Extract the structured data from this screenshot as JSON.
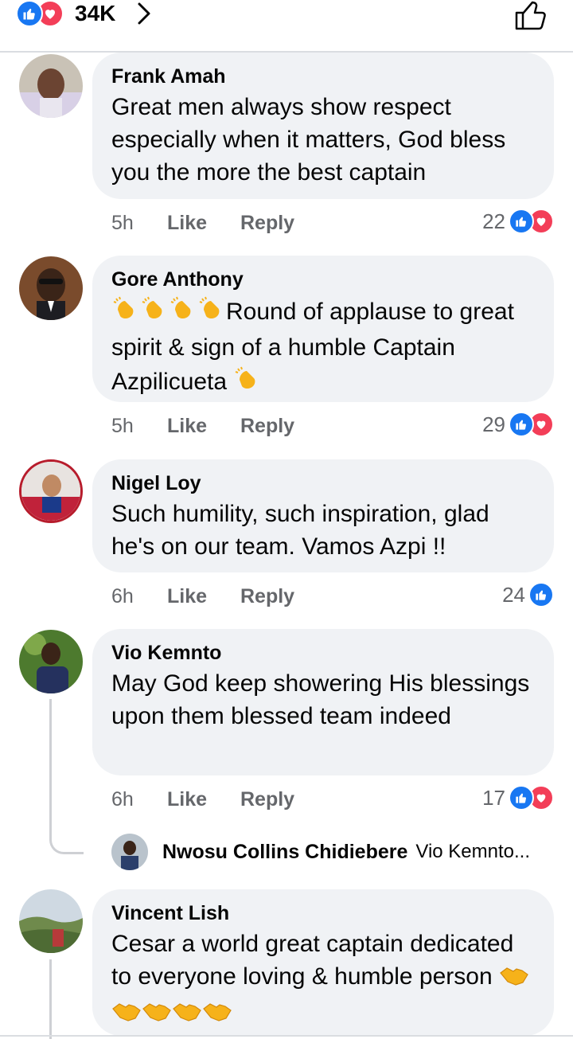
{
  "colors": {
    "like_blue": "#1877f2",
    "love_red": "#f33e58",
    "bubble_bg": "#f0f2f5",
    "meta_gray": "#65676b"
  },
  "header": {
    "reaction_count": "34K",
    "icons": [
      "like-icon",
      "love-icon",
      "chevron-right-icon",
      "thumbs-up-outline-icon"
    ]
  },
  "comments": [
    {
      "name": "Frank Amah",
      "text": "Great men always show respect especially when it matters, God bless you the more the best captain",
      "time": "5h",
      "like": "Like",
      "reply": "Reply",
      "reactions": "22"
    },
    {
      "name": "Gore Anthony",
      "text": "Round of applause to great spirit & sign of a humble Captain Azpilicueta",
      "time": "5h",
      "like": "Like",
      "reply": "Reply",
      "reactions": "29"
    },
    {
      "name": "Nigel Loy",
      "text": "Such humility, such inspiration, glad he's on our team. Vamos Azpi !!",
      "time": "6h",
      "like": "Like",
      "reply": "Reply",
      "reactions": "24"
    },
    {
      "name": "Vio Kemnto",
      "text": "May God keep showering His blessings upon them blessed team indeed",
      "time": "6h",
      "like": "Like",
      "reply": "Reply",
      "reactions": "17"
    },
    {
      "name": "Vincent Lish",
      "text": "Cesar a world great captain dedicated to everyone loving & humble person"
    }
  ],
  "reply_preview": {
    "name": "Nwosu Collins Chidiebere",
    "snippet": "Vio Kemnto..."
  },
  "emoji": {
    "clap": "clapping-hands-emoji",
    "handshake": "handshake-emoji"
  }
}
